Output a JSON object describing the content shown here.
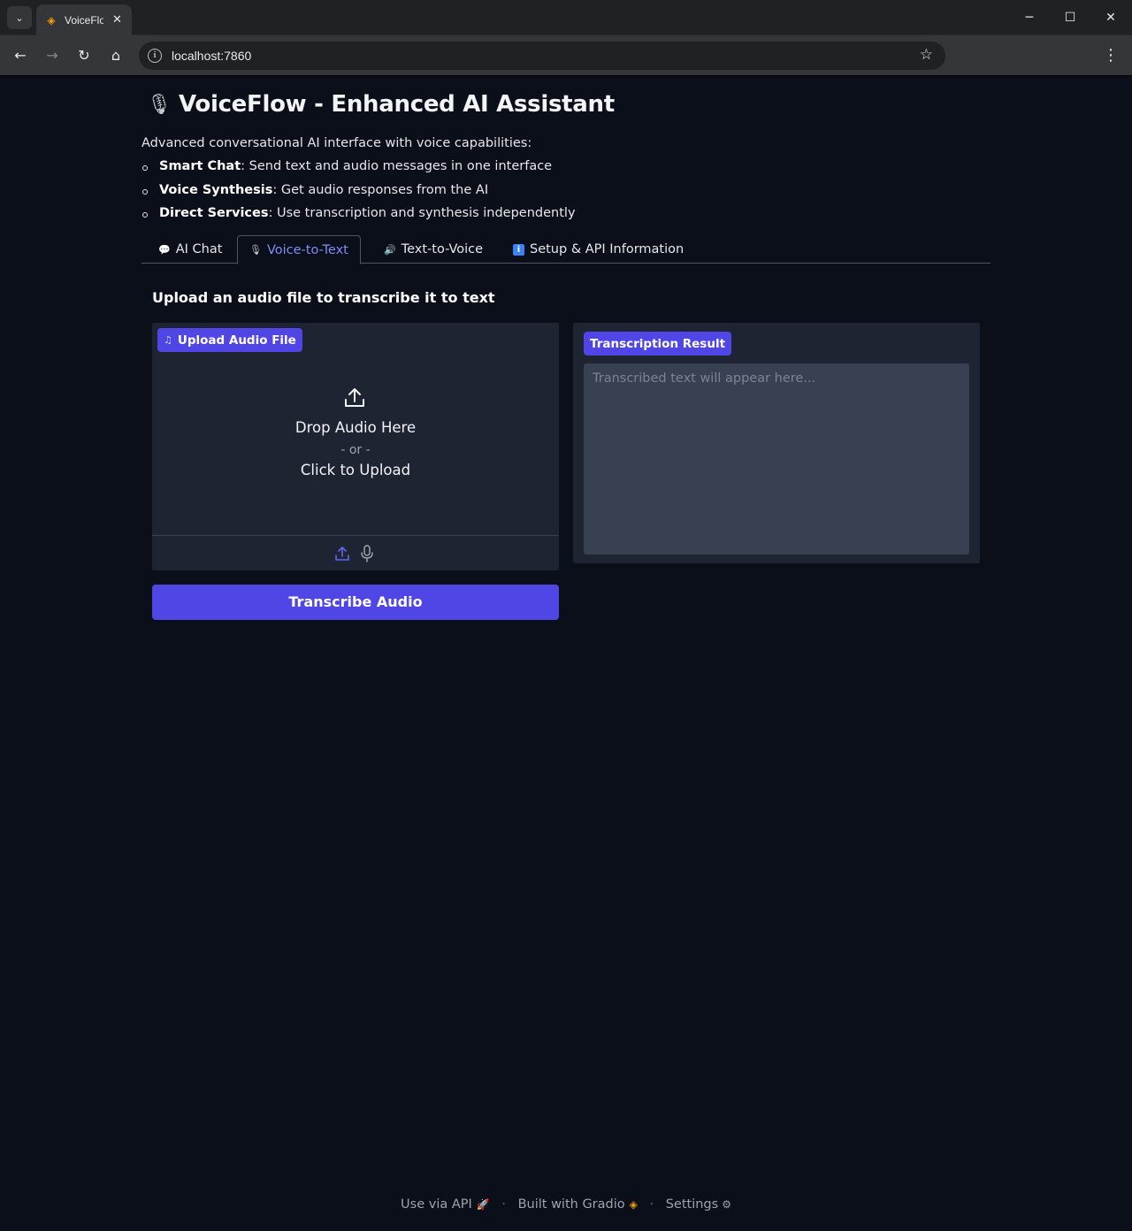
{
  "browser": {
    "tab_title": "VoiceFlow",
    "url": "localhost:7860"
  },
  "header": {
    "title": "VoiceFlow - Enhanced AI Assistant",
    "intro": "Advanced conversational AI interface with voice capabilities:",
    "features": [
      {
        "name": "Smart Chat",
        "desc": ": Send text and audio messages in one interface"
      },
      {
        "name": "Voice Synthesis",
        "desc": ": Get audio responses from the AI"
      },
      {
        "name": "Direct Services",
        "desc": ": Use transcription and synthesis independently"
      }
    ]
  },
  "tabs": [
    {
      "label": "AI Chat",
      "icon": "speech-bubble-icon"
    },
    {
      "label": "Voice-to-Text",
      "icon": "microphone-icon",
      "active": true
    },
    {
      "label": "Text-to-Voice",
      "icon": "speaker-icon"
    },
    {
      "label": "Setup & API Information",
      "icon": "info-icon"
    }
  ],
  "main": {
    "heading": "Upload an audio file to transcribe it to text",
    "upload": {
      "label": "Upload Audio File",
      "drop_text": "Drop Audio Here",
      "or_text": "- or -",
      "click_text": "Click to Upload"
    },
    "transcribe_button": "Transcribe Audio",
    "result": {
      "label": "Transcription Result",
      "placeholder": "Transcribed text will appear here..."
    }
  },
  "footer": {
    "api": "Use via API",
    "built": "Built with Gradio",
    "settings": "Settings",
    "separator": "·"
  },
  "colors": {
    "background": "#0b0f19",
    "accent": "#4f46e5",
    "panel": "#1f2433",
    "active_tab": "#818cf8"
  }
}
